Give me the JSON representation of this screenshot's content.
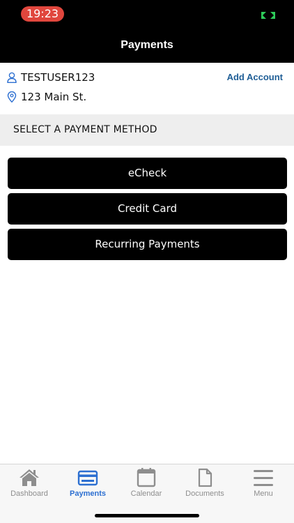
{
  "status_bar": {
    "time": "19:23"
  },
  "header": {
    "title": "Payments"
  },
  "account": {
    "username": "TESTUSER123",
    "address": "123 Main St.",
    "add_account_label": "Add Account"
  },
  "section": {
    "title": "SELECT A PAYMENT METHOD"
  },
  "payment_methods": [
    {
      "label": "eCheck"
    },
    {
      "label": "Credit Card"
    },
    {
      "label": "Recurring Payments"
    }
  ],
  "tabs": [
    {
      "label": "Dashboard",
      "icon": "home-icon",
      "active": false
    },
    {
      "label": "Payments",
      "icon": "credit-card-icon",
      "active": true
    },
    {
      "label": "Calendar",
      "icon": "calendar-icon",
      "active": false
    },
    {
      "label": "Documents",
      "icon": "document-icon",
      "active": false
    },
    {
      "label": "Menu",
      "icon": "hamburger-menu-icon",
      "active": false
    }
  ],
  "colors": {
    "accent": "#2c6fd1",
    "link": "#1f5e96",
    "time_pill": "#e0463d",
    "inactive_tab": "#8e8e8e"
  }
}
